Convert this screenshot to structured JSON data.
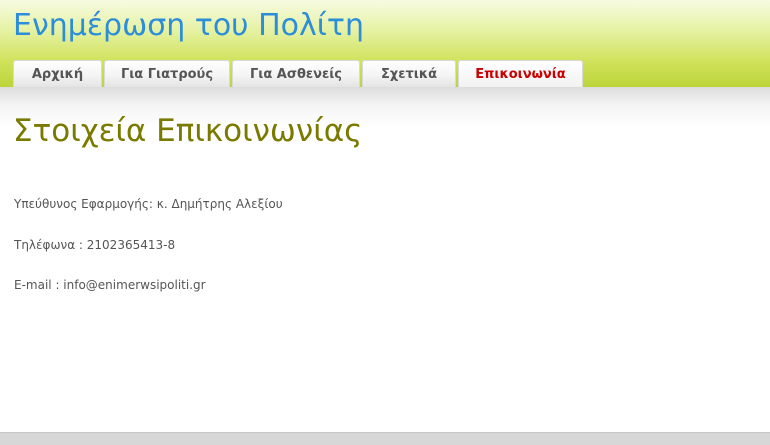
{
  "site": {
    "title": "Ενημέρωση του Πολίτη"
  },
  "nav": {
    "tabs": [
      {
        "label": "Αρχική",
        "active": false
      },
      {
        "label": "Για Γιατρούς",
        "active": false
      },
      {
        "label": "Για Ασθενείς",
        "active": false
      },
      {
        "label": "Σχετικά",
        "active": false
      },
      {
        "label": "Επικοινωνία",
        "active": true
      }
    ]
  },
  "main": {
    "title": "Στοιχεία Επικοινωνίας",
    "responsible": "Υπεύθυνος Εφαρμογής: κ. Δημήτρης Αλεξίου",
    "phone": "Τηλέφωνα : 2102365413-8",
    "email": "E-mail : info@enimerwsipoliti.gr"
  },
  "colors": {
    "title": "#2c8ed8",
    "active_tab": "#cc0000",
    "page_title": "#7a7a00"
  }
}
